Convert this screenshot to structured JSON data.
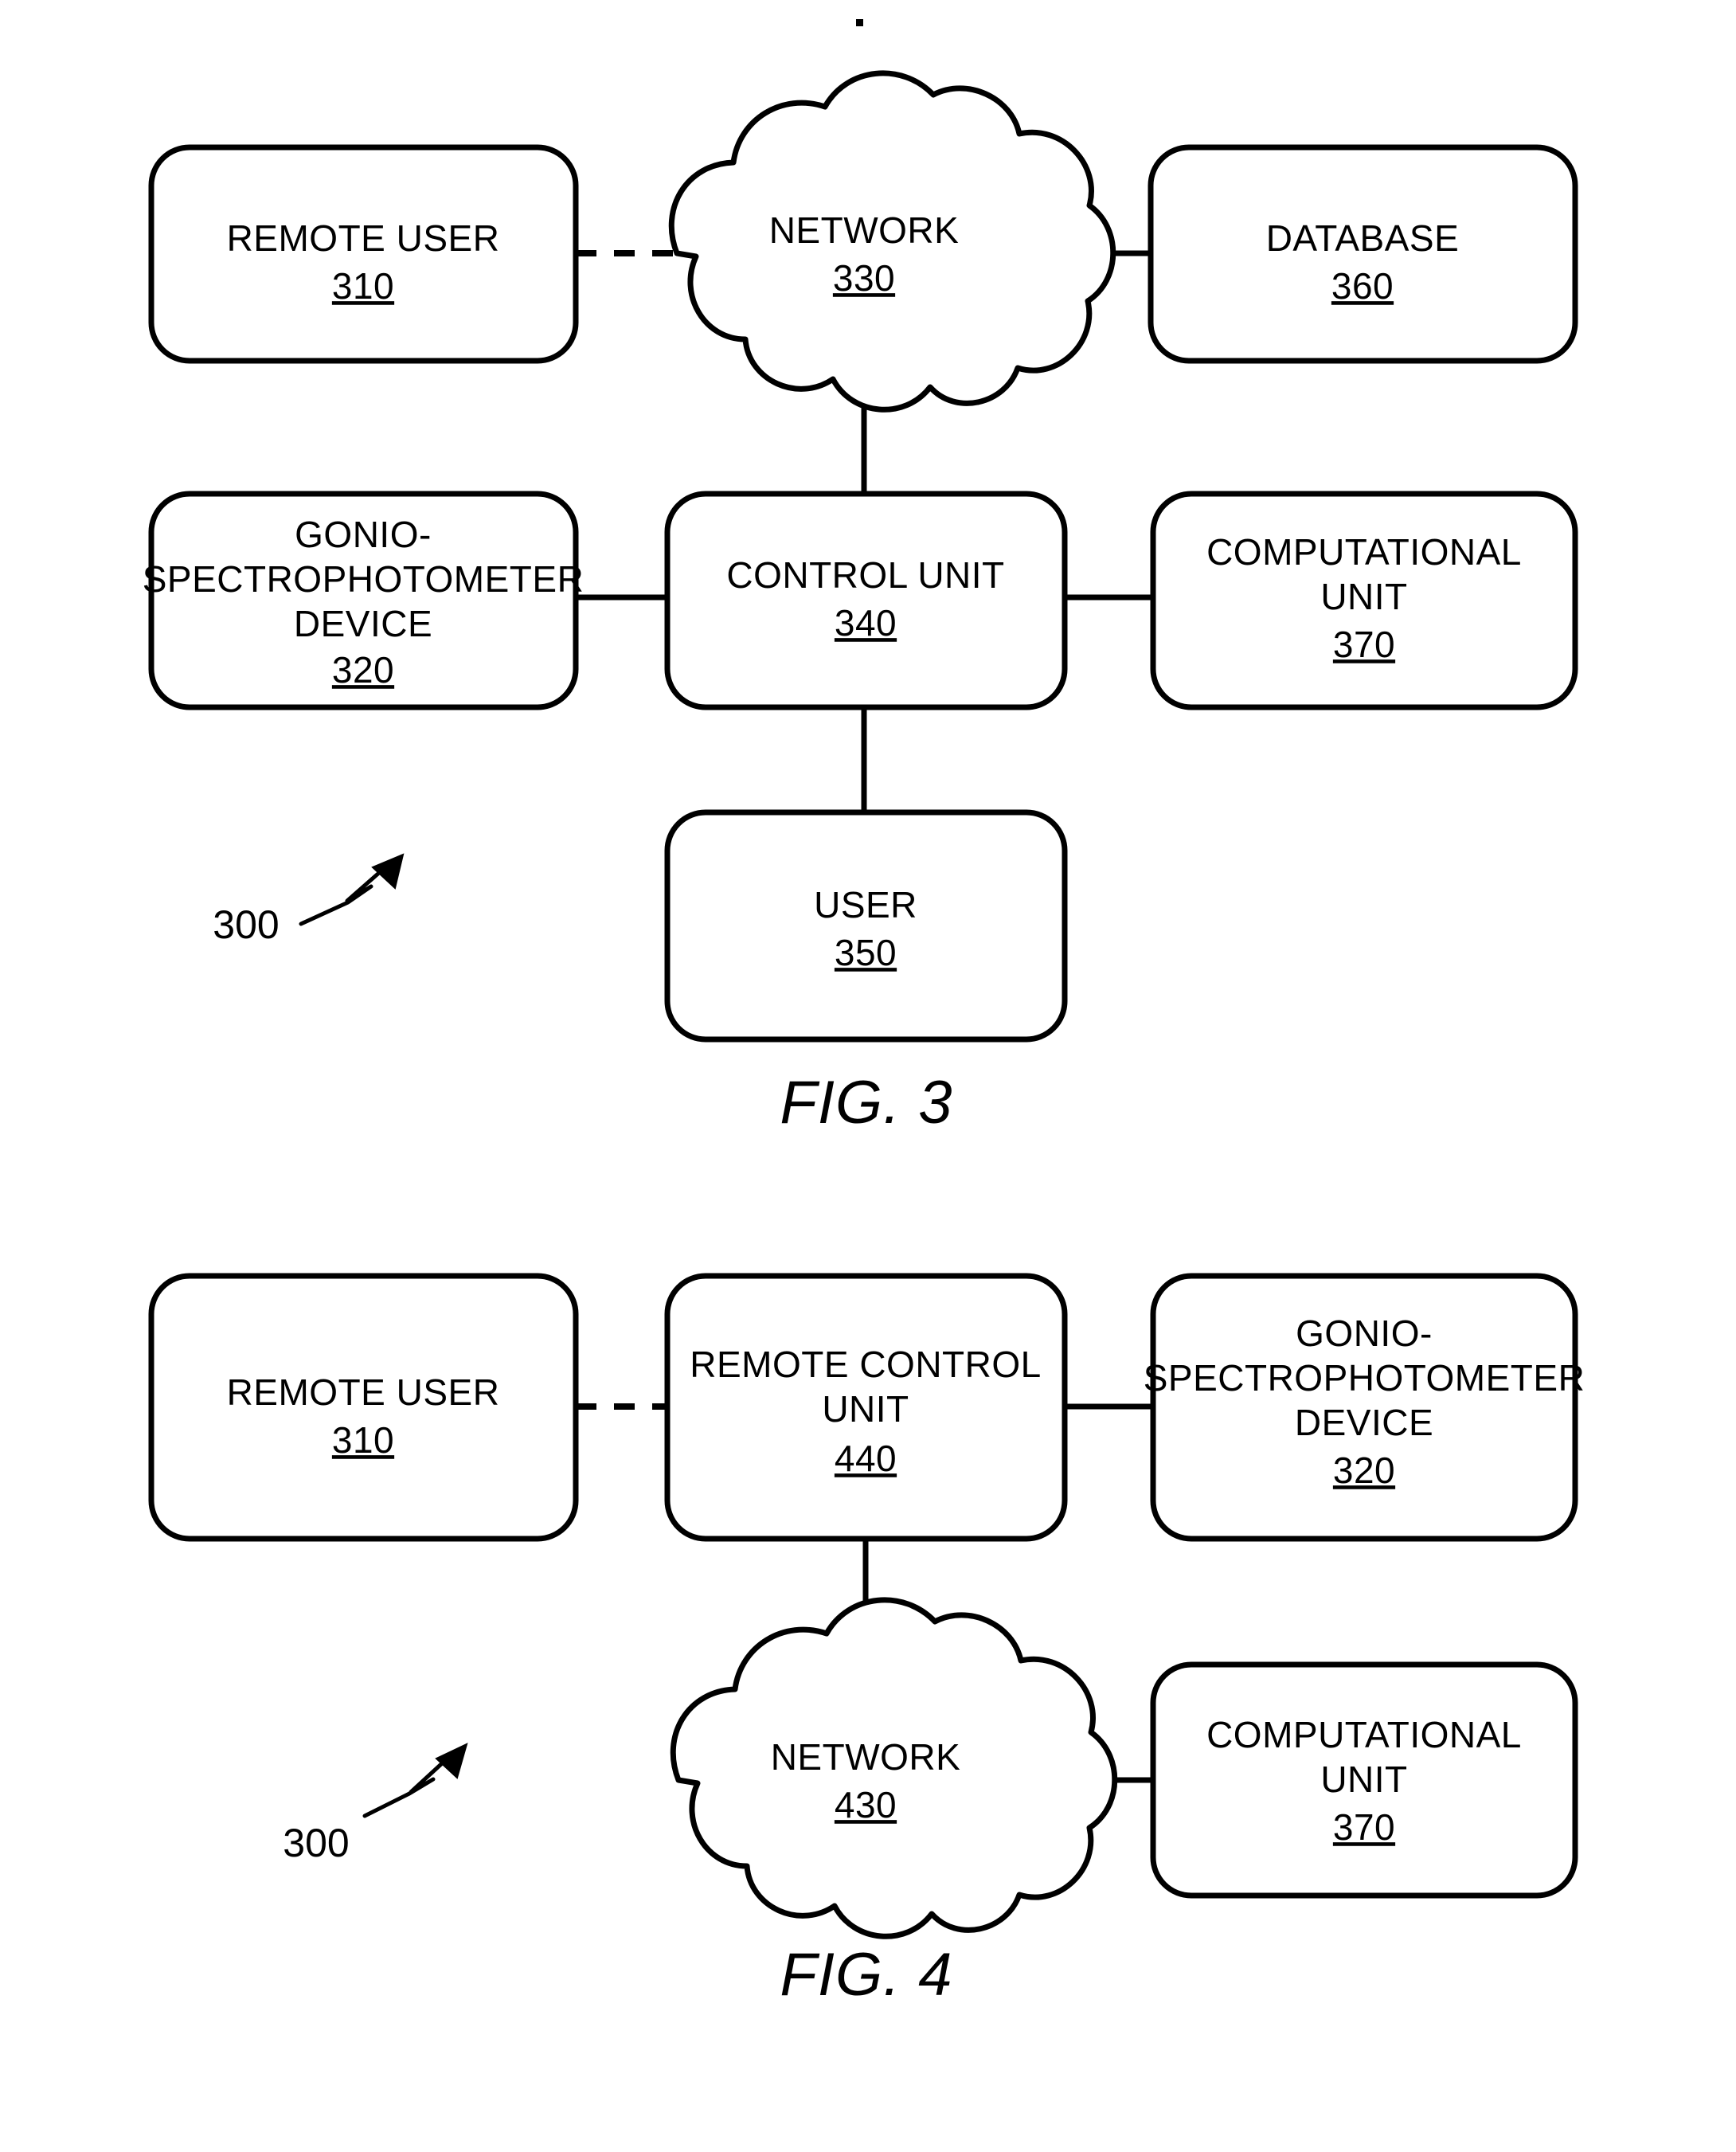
{
  "page": {
    "background": "#ffffff",
    "ink": "#000000",
    "type": "patent-figure-sheet"
  },
  "figures": [
    {
      "id": "fig3",
      "caption": "FIG. 3",
      "reference_numeral": "300",
      "nodes": [
        {
          "id": "remote-user-310",
          "shape": "rounded-rect",
          "label_lines": [
            "REMOTE USER"
          ],
          "number": "310"
        },
        {
          "id": "network-330",
          "shape": "cloud",
          "label_lines": [
            "NETWORK"
          ],
          "number": "330"
        },
        {
          "id": "database-360",
          "shape": "rounded-rect",
          "label_lines": [
            "DATABASE"
          ],
          "number": "360"
        },
        {
          "id": "gonio-320",
          "shape": "rounded-rect",
          "label_lines": [
            "GONIO-",
            "SPECTROPHOTOMETER",
            "DEVICE"
          ],
          "number": "320"
        },
        {
          "id": "control-unit-340",
          "shape": "rounded-rect",
          "label_lines": [
            "CONTROL UNIT"
          ],
          "number": "340"
        },
        {
          "id": "computational-370",
          "shape": "rounded-rect",
          "label_lines": [
            "COMPUTATIONAL",
            "UNIT"
          ],
          "number": "370"
        },
        {
          "id": "user-350",
          "shape": "rounded-rect",
          "label_lines": [
            "USER"
          ],
          "number": "350"
        }
      ],
      "connections": [
        {
          "from": "remote-user-310",
          "to": "network-330",
          "style": "dashed"
        },
        {
          "from": "network-330",
          "to": "database-360",
          "style": "solid"
        },
        {
          "from": "network-330",
          "to": "control-unit-340",
          "style": "solid"
        },
        {
          "from": "gonio-320",
          "to": "control-unit-340",
          "style": "solid"
        },
        {
          "from": "control-unit-340",
          "to": "computational-370",
          "style": "solid"
        },
        {
          "from": "control-unit-340",
          "to": "user-350",
          "style": "solid"
        }
      ]
    },
    {
      "id": "fig4",
      "caption": "FIG. 4",
      "reference_numeral": "300",
      "nodes": [
        {
          "id": "remote-user-310",
          "shape": "rounded-rect",
          "label_lines": [
            "REMOTE USER"
          ],
          "number": "310"
        },
        {
          "id": "remote-control-440",
          "shape": "rounded-rect",
          "label_lines": [
            "REMOTE CONTROL",
            "UNIT"
          ],
          "number": "440"
        },
        {
          "id": "gonio-320",
          "shape": "rounded-rect",
          "label_lines": [
            "GONIO-",
            "SPECTROPHOTOMETER",
            "DEVICE"
          ],
          "number": "320"
        },
        {
          "id": "network-430",
          "shape": "cloud",
          "label_lines": [
            "NETWORK"
          ],
          "number": "430"
        },
        {
          "id": "computational-370",
          "shape": "rounded-rect",
          "label_lines": [
            "COMPUTATIONAL",
            "UNIT"
          ],
          "number": "370"
        }
      ],
      "connections": [
        {
          "from": "remote-user-310",
          "to": "remote-control-440",
          "style": "dashed"
        },
        {
          "from": "remote-control-440",
          "to": "gonio-320",
          "style": "solid"
        },
        {
          "from": "remote-control-440",
          "to": "network-430",
          "style": "solid"
        },
        {
          "from": "network-430",
          "to": "computational-370",
          "style": "solid"
        }
      ]
    }
  ],
  "fig3": {
    "caption": "FIG. 3",
    "ref": "300",
    "remote_user": {
      "l1": "REMOTE USER",
      "num": "310"
    },
    "network": {
      "l1": "NETWORK",
      "num": "330"
    },
    "database": {
      "l1": "DATABASE",
      "num": "360"
    },
    "gonio": {
      "l1": "GONIO-",
      "l2": "SPECTROPHOTOMETER",
      "l3": "DEVICE",
      "num": "320"
    },
    "control": {
      "l1": "CONTROL UNIT",
      "num": "340"
    },
    "computational": {
      "l1": "COMPUTATIONAL",
      "l2": "UNIT",
      "num": "370"
    },
    "user": {
      "l1": "USER",
      "num": "350"
    }
  },
  "fig4": {
    "caption": "FIG. 4",
    "ref": "300",
    "remote_user": {
      "l1": "REMOTE USER",
      "num": "310"
    },
    "remote_control": {
      "l1": "REMOTE CONTROL",
      "l2": "UNIT",
      "num": "440"
    },
    "gonio": {
      "l1": "GONIO-",
      "l2": "SPECTROPHOTOMETER",
      "l3": "DEVICE",
      "num": "320"
    },
    "network": {
      "l1": "NETWORK",
      "num": "430"
    },
    "computational": {
      "l1": "COMPUTATIONAL",
      "l2": "UNIT",
      "num": "370"
    }
  }
}
